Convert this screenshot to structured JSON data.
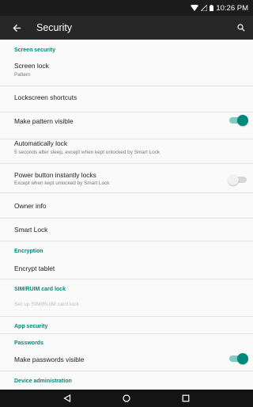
{
  "status_bar": {
    "time": "10:26 PM",
    "icons": [
      "wifi-icon",
      "signal-icon",
      "battery-icon"
    ]
  },
  "app_bar": {
    "title": "Security",
    "icons": [
      "back-arrow-icon",
      "search-icon"
    ]
  },
  "colors": {
    "accent": "#00897b",
    "app_bar": "#272727",
    "status_bar": "#1c1c1c",
    "nav_bar": "#141414",
    "background": "#fafafa"
  },
  "sections": {
    "screen_security": {
      "header": "Screen security",
      "screen_lock": {
        "title": "Screen lock",
        "summary": "Pattern"
      },
      "lockscreen_shortcuts": {
        "title": "Lockscreen shortcuts"
      },
      "make_pattern_visible": {
        "title": "Make pattern visible",
        "enabled": true
      },
      "automatically_lock": {
        "title": "Automatically lock",
        "summary": "5 seconds after sleep, except when kept unlocked by Smart Lock"
      },
      "power_button_locks": {
        "title": "Power button instantly locks",
        "summary": "Except when kept unlocked by Smart Lock",
        "enabled": false
      },
      "owner_info": {
        "title": "Owner info"
      },
      "smart_lock": {
        "title": "Smart Lock"
      }
    },
    "encryption": {
      "header": "Encryption",
      "encrypt_tablet": {
        "title": "Encrypt tablet"
      }
    },
    "sim_lock": {
      "header": "SIM/RUIM card lock",
      "setup": {
        "title": "Set up SIM/RUIM card lock",
        "disabled": true
      }
    },
    "app_security": {
      "header": "App security"
    },
    "passwords": {
      "header": "Passwords",
      "make_passwords_visible": {
        "title": "Make passwords visible",
        "enabled": true
      }
    },
    "device_administration": {
      "header": "Device administration"
    }
  },
  "nav_bar": {
    "icons": [
      "back-triangle-icon",
      "home-circle-icon",
      "recents-square-icon"
    ]
  }
}
